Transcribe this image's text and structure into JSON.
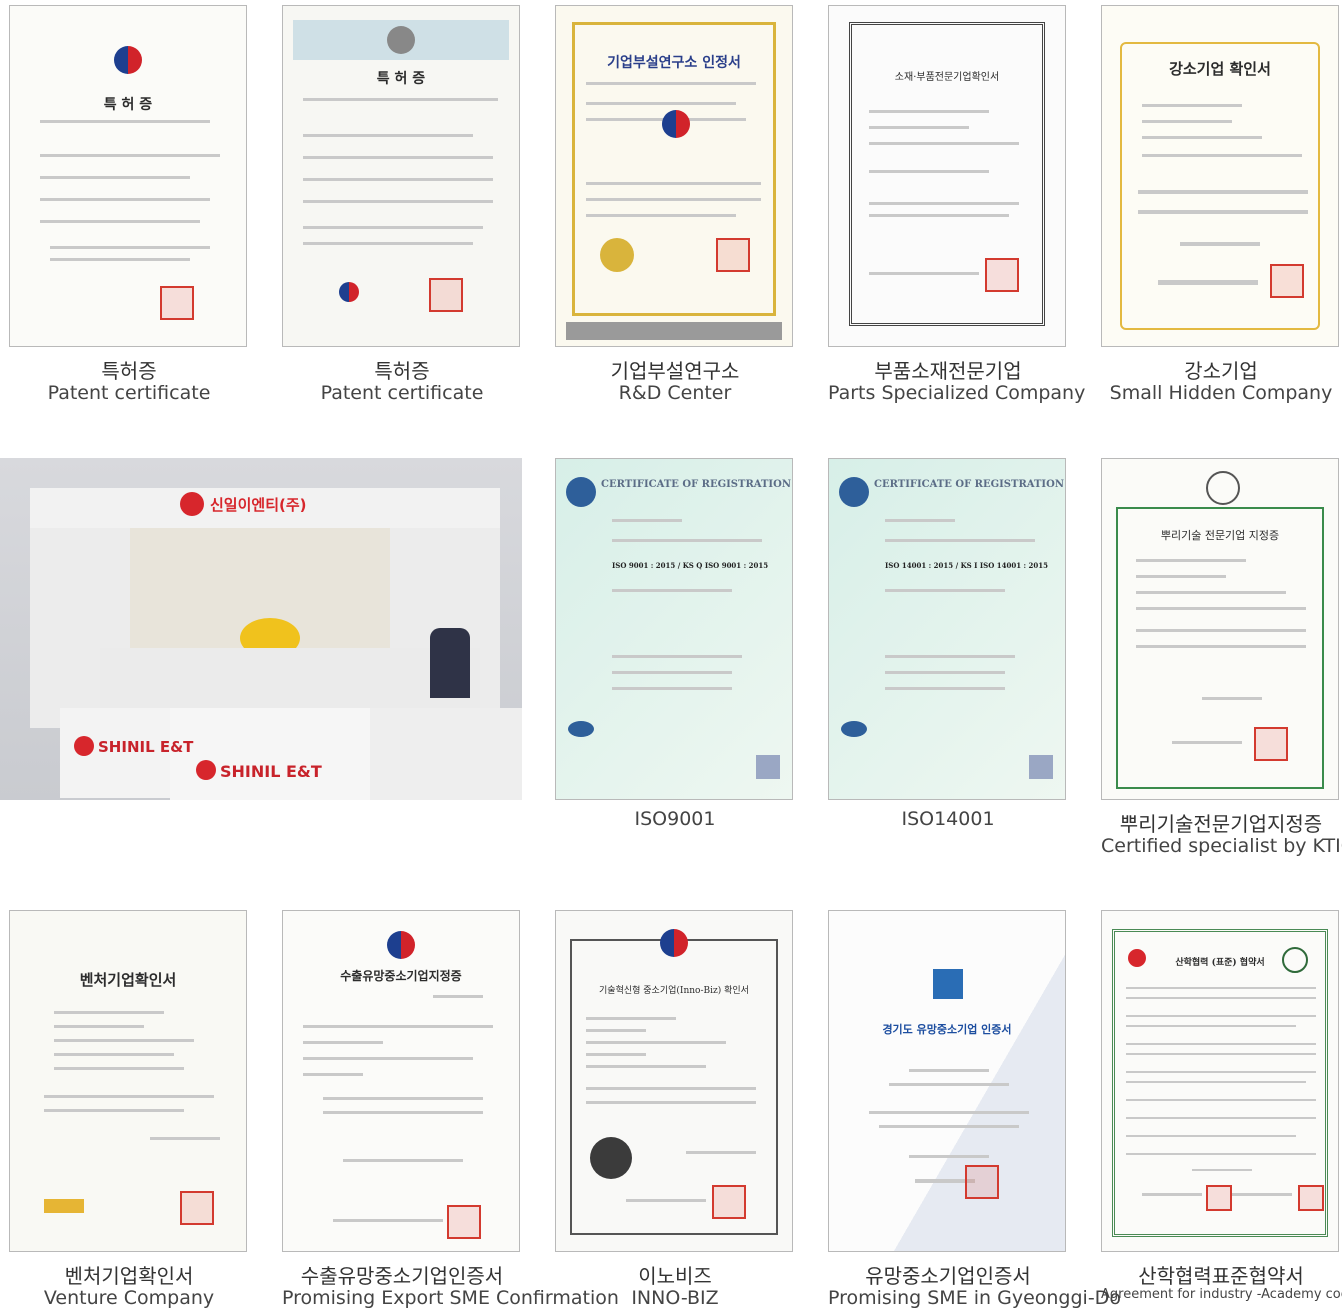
{
  "certificates": [
    {
      "title_ko": "특허증",
      "title_en": "Patent certificate",
      "doc_heading": "특 허 증",
      "style": "patent"
    },
    {
      "title_ko": "특허증",
      "title_en": "Patent certificate",
      "doc_heading": "특 허 증",
      "style": "patent2"
    },
    {
      "title_ko": "기업부설연구소",
      "title_en": "R&D Center",
      "doc_heading": "기업부설연구소 인정서",
      "style": "gold"
    },
    {
      "title_ko": "부품소재전문기업",
      "title_en": "Parts Specialized Company",
      "doc_heading": "소재·부품전문기업확인서",
      "style": "frame"
    },
    {
      "title_ko": "강소기업",
      "title_en": "Small Hidden Company",
      "doc_heading": "강소기업 확인서",
      "style": "yellow"
    },
    {
      "title_ko": "",
      "title_en": "ISO9001",
      "doc_heading": "CERTIFICATE OF REGISTRATION",
      "doc_sub": "ISO 9001 : 2015 / KS Q ISO 9001 : 2015",
      "style": "iso"
    },
    {
      "title_ko": "",
      "title_en": "ISO14001",
      "doc_heading": "CERTIFICATE OF REGISTRATION",
      "doc_sub": "ISO 14001 : 2015 / KS I ISO 14001 : 2015",
      "style": "iso"
    },
    {
      "title_ko": "뿌리기술전문기업지정증",
      "title_en": "Certified specialist by KTIC",
      "doc_heading": "뿌리기술 전문기업 지정증",
      "style": "green"
    },
    {
      "title_ko": "벤처기업확인서",
      "title_en": "Venture Company",
      "doc_heading": "벤처기업확인서",
      "style": "venture"
    },
    {
      "title_ko": "수출유망중소기업인증서",
      "title_en": "Promising Export SME Confirmation",
      "doc_heading": "수출유망중소기업지정증",
      "style": "export"
    },
    {
      "title_ko": "이노비즈",
      "title_en": "INNO-BIZ",
      "doc_heading": "기술혁신형 중소기업(Inno-Biz) 확인서",
      "style": "inno"
    },
    {
      "title_ko": "유망중소기업인증서",
      "title_en": "Promising SME in Gyeonggi-Do",
      "doc_heading": "경기도 유망중소기업 인증서",
      "style": "gyeonggi"
    },
    {
      "title_ko": "산학협력표준협약서",
      "title_en": "Agreement for industry -Academy cooperation",
      "doc_heading": "산학협력 (표준) 협약서",
      "style": "agreement"
    }
  ],
  "booth": {
    "sign1": "SHINIL E&T",
    "sign2": "SHINIL E&T",
    "brand": "신일이엔티(주)"
  }
}
